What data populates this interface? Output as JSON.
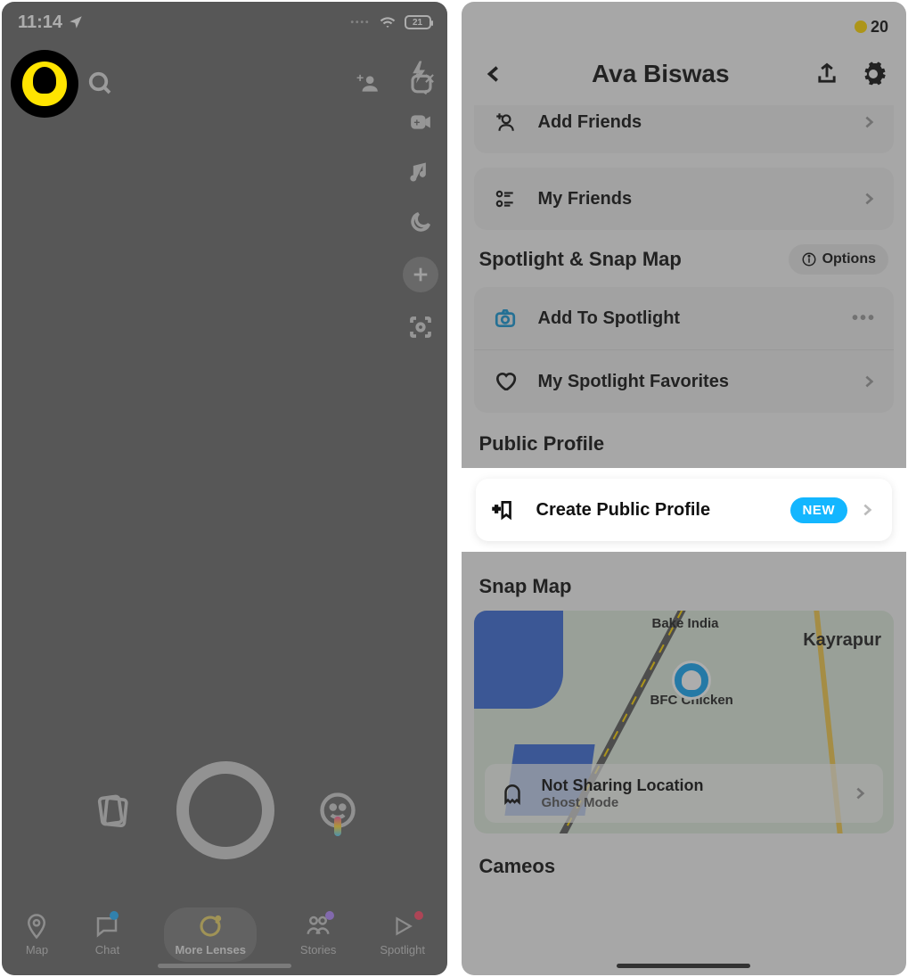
{
  "left": {
    "status": {
      "time": "11:14",
      "battery": "21"
    },
    "nav": {
      "map": "Map",
      "chat": "Chat",
      "lenses": "More Lenses",
      "stories": "Stories",
      "spotlight": "Spotlight"
    }
  },
  "right": {
    "coin_count": "20",
    "header": {
      "title": "Ava Biswas"
    },
    "rows": {
      "add_friends": "Add Friends",
      "my_friends": "My Friends",
      "add_spotlight": "Add To Spotlight",
      "fav_spotlight": "My Spotlight Favorites",
      "create_public": "Create Public Profile",
      "new_badge": "NEW",
      "not_sharing": "Not Sharing Location",
      "ghost": "Ghost Mode"
    },
    "sections": {
      "spotlight": "Spotlight & Snap Map",
      "options": "Options",
      "public_profile": "Public Profile",
      "snap_map": "Snap Map",
      "cameos": "Cameos"
    },
    "map_labels": {
      "bake": "Bake India",
      "kayrapur": "Kayrapur",
      "bfc": "BFC Chicken"
    }
  }
}
